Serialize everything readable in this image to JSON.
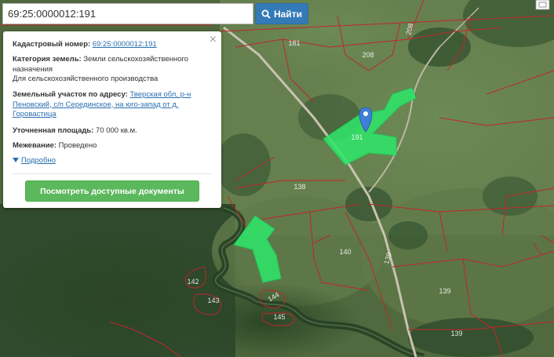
{
  "search": {
    "value": "69:25:0000012:191",
    "button_label": "Найти"
  },
  "panel": {
    "close_label": "×",
    "cadastral_label": "Кадастровый номер:",
    "cadastral_value": "69:25:0000012:191",
    "category_label": "Категория земель:",
    "category_value": "Земли сельскохозяйственного назначения",
    "usage_value": "Для сельскохозяйственного производства",
    "address_label": "Земельный участок по адресу:",
    "address_value": "Тверская обл, р-н Пеновский, с/п Серединское, на юго-запад от д. Горовастица",
    "area_label": "Уточненная площадь:",
    "area_value": "70 000 кв.м.",
    "survey_label": "Межевание:",
    "survey_value": "Проведено",
    "details_label": "Подробно",
    "docs_button": "Посмотреть доступные документы"
  },
  "map": {
    "parcel_labels": [
      "181",
      "208",
      "208",
      "191",
      "138",
      "140",
      "139",
      "139",
      "139",
      "142",
      "143",
      "144",
      "145"
    ],
    "highlight_color": "#2ee86a",
    "boundary_color": "#c0262c",
    "marker_color": "#3f7fd6"
  }
}
